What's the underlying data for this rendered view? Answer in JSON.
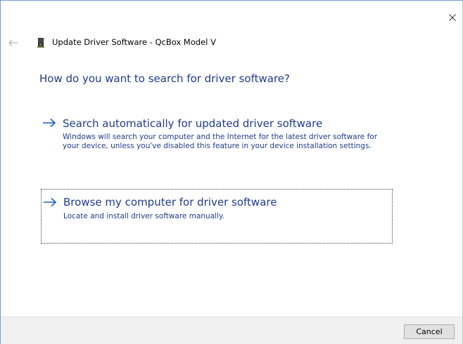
{
  "window": {
    "header_title": "Update Driver Software - QcBox Model V"
  },
  "question": "How do you want to search for driver software?",
  "options": [
    {
      "title": "Search automatically for updated driver software",
      "description": "Windows will search your computer and the Internet for the latest driver software for your device, unless you've disabled this feature in your device installation settings."
    },
    {
      "title": "Browse my computer for driver software",
      "description": "Locate and install driver software manually."
    }
  ],
  "footer": {
    "cancel_label": "Cancel"
  },
  "colors": {
    "link_blue": "#1f3b8c",
    "arrow_blue": "#1b5fc1",
    "footer_bg": "#f0f0f0"
  },
  "icons": {
    "close": "close-icon",
    "back": "back-arrow-icon",
    "device": "device-icon",
    "option_arrow": "right-arrow-icon"
  }
}
